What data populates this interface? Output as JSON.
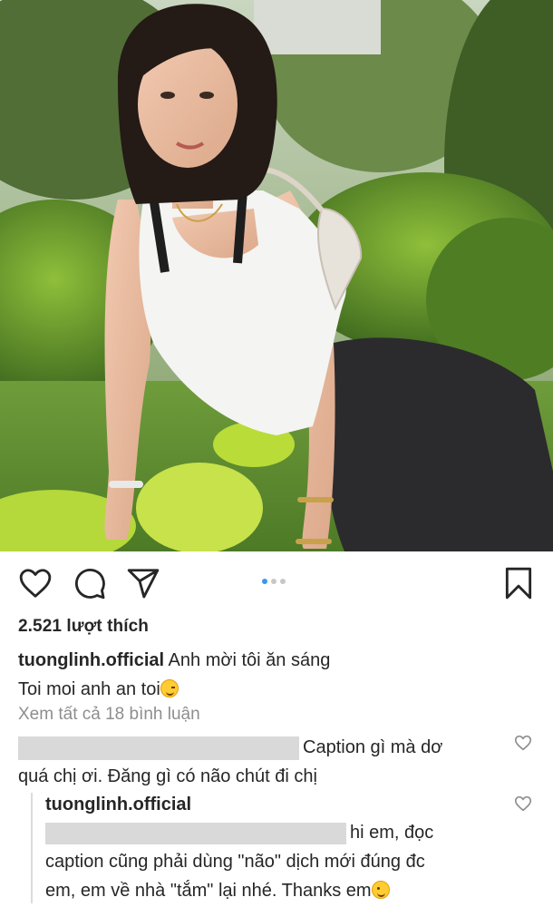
{
  "post": {
    "likes": "2.521 lượt thích",
    "caption_user": "tuonglinh.official",
    "caption_line1": "Anh mời tôi ăn sáng",
    "caption_line2": "Toi moi anh an toi",
    "caption_emoji": "winking-face-emoji",
    "view_all_comments": "Xem tất cả 18 bình luận",
    "carousel": {
      "count": 3,
      "active": 1
    }
  },
  "comments": [
    {
      "user_redacted": true,
      "text_line1": "Caption gì mà dơ",
      "text_line2": "quá chị ơi. Đăng gì có não chút đi chị"
    }
  ],
  "reply": {
    "user": "tuonglinh.official",
    "user_redacted": true,
    "text_line1": "hi em, đọc",
    "text_line2": "caption cũng phải dùng \"não\" dịch mới đúng đc",
    "text_line3": "em, em về nhà \"tắm\" lại nhé. Thanks em",
    "emoji": "smiling-face-emoji"
  },
  "icons": {
    "like": "heart-icon",
    "comment": "comment-bubble-icon",
    "share": "paper-plane-icon",
    "save": "bookmark-icon",
    "comment_like": "small-heart-icon"
  },
  "colors": {
    "text": "#262626",
    "muted": "#8e8e8e",
    "accent_dot": "#3897f0",
    "redaction": "#d9d9d9"
  }
}
